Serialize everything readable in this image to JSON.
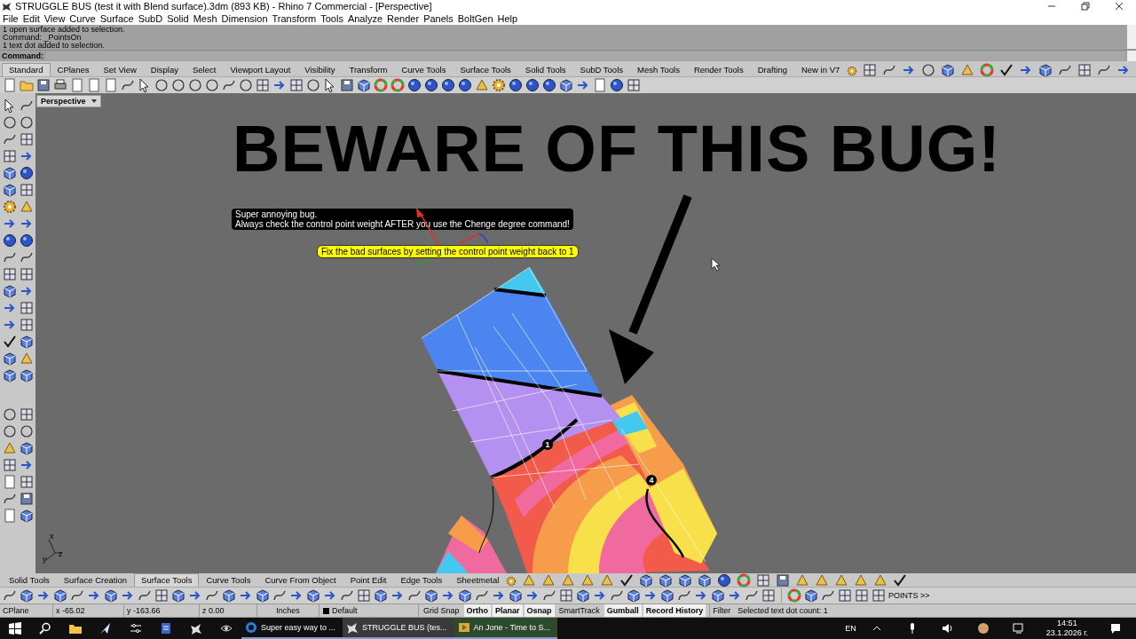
{
  "window": {
    "title": "STRUGGLE BUS (test it with Blend surface).3dm (893 KB) - Rhino 7 Commercial - [Perspective]"
  },
  "menu": [
    "File",
    "Edit",
    "View",
    "Curve",
    "Surface",
    "SubD",
    "Solid",
    "Mesh",
    "Dimension",
    "Transform",
    "Tools",
    "Analyze",
    "Render",
    "Panels",
    "BoltGen",
    "Help"
  ],
  "command_history": [
    "1 open surface added to selection.",
    "Command: _PointsOn",
    "1 text dot added to selection."
  ],
  "command_prompt": "Command:",
  "top_tabs": [
    {
      "label": "Standard",
      "selected": true
    },
    {
      "label": "CPlanes",
      "selected": false
    },
    {
      "label": "Set View",
      "selected": false
    },
    {
      "label": "Display",
      "selected": false
    },
    {
      "label": "Select",
      "selected": false
    },
    {
      "label": "Viewport Layout",
      "selected": false
    },
    {
      "label": "Visibility",
      "selected": false
    },
    {
      "label": "Transform",
      "selected": false
    },
    {
      "label": "Curve Tools",
      "selected": false
    },
    {
      "label": "Surface Tools",
      "selected": false
    },
    {
      "label": "Solid Tools",
      "selected": false
    },
    {
      "label": "SubD Tools",
      "selected": false
    },
    {
      "label": "Mesh Tools",
      "selected": false
    },
    {
      "label": "Render Tools",
      "selected": false
    },
    {
      "label": "Drafting",
      "selected": false
    },
    {
      "label": "New in V7",
      "selected": false
    }
  ],
  "viewport": {
    "label": "Perspective",
    "headline": "BEWARE OF THIS BUG!",
    "notes": [
      {
        "kind": "dark",
        "lines": [
          "Super annoying bug.",
          "Always check the control point weight AFTER you use the Chenge degree command!"
        ]
      },
      {
        "kind": "yellow",
        "lines": [
          "Fix the bad surfaces by setting the control point weight back to 1"
        ]
      }
    ],
    "dots": [
      "1",
      "4"
    ],
    "axes": [
      "x",
      "y",
      "z"
    ]
  },
  "bottom_tabs": [
    {
      "label": "Solid Tools",
      "selected": false
    },
    {
      "label": "Surface Creation",
      "selected": false
    },
    {
      "label": "Surface Tools",
      "selected": true
    },
    {
      "label": "Curve Tools",
      "selected": false
    },
    {
      "label": "Curve From Object",
      "selected": false
    },
    {
      "label": "Point Edit",
      "selected": false
    },
    {
      "label": "Edge Tools",
      "selected": false
    },
    {
      "label": "Sheetmetal",
      "selected": false
    }
  ],
  "bottom_overflow": "POINTS >>",
  "status": {
    "cplane": "CPlane",
    "x": "x -65.02",
    "y": "y -163.66",
    "z": "z 0.00",
    "units": "Inches",
    "layer": "Default",
    "toggles": [
      {
        "label": "Grid Snap",
        "on": false
      },
      {
        "label": "Ortho",
        "on": true
      },
      {
        "label": "Planar",
        "on": true
      },
      {
        "label": "Osnap",
        "on": true
      },
      {
        "label": "SmartTrack",
        "on": false
      },
      {
        "label": "Gumball",
        "on": true
      },
      {
        "label": "Record History",
        "on": true
      }
    ],
    "filter": "Filter",
    "message": "Selected text dot count: 1"
  },
  "taskbar": {
    "apps": [
      {
        "label": "Super easy way to ...",
        "selected": false
      },
      {
        "label": "STRUGGLE BUS (tes...",
        "selected": true
      },
      {
        "label": "An Jone - Time to S...",
        "selected": false
      }
    ],
    "language": "EN",
    "time": "14:51",
    "date": "23.1.2026 г."
  }
}
